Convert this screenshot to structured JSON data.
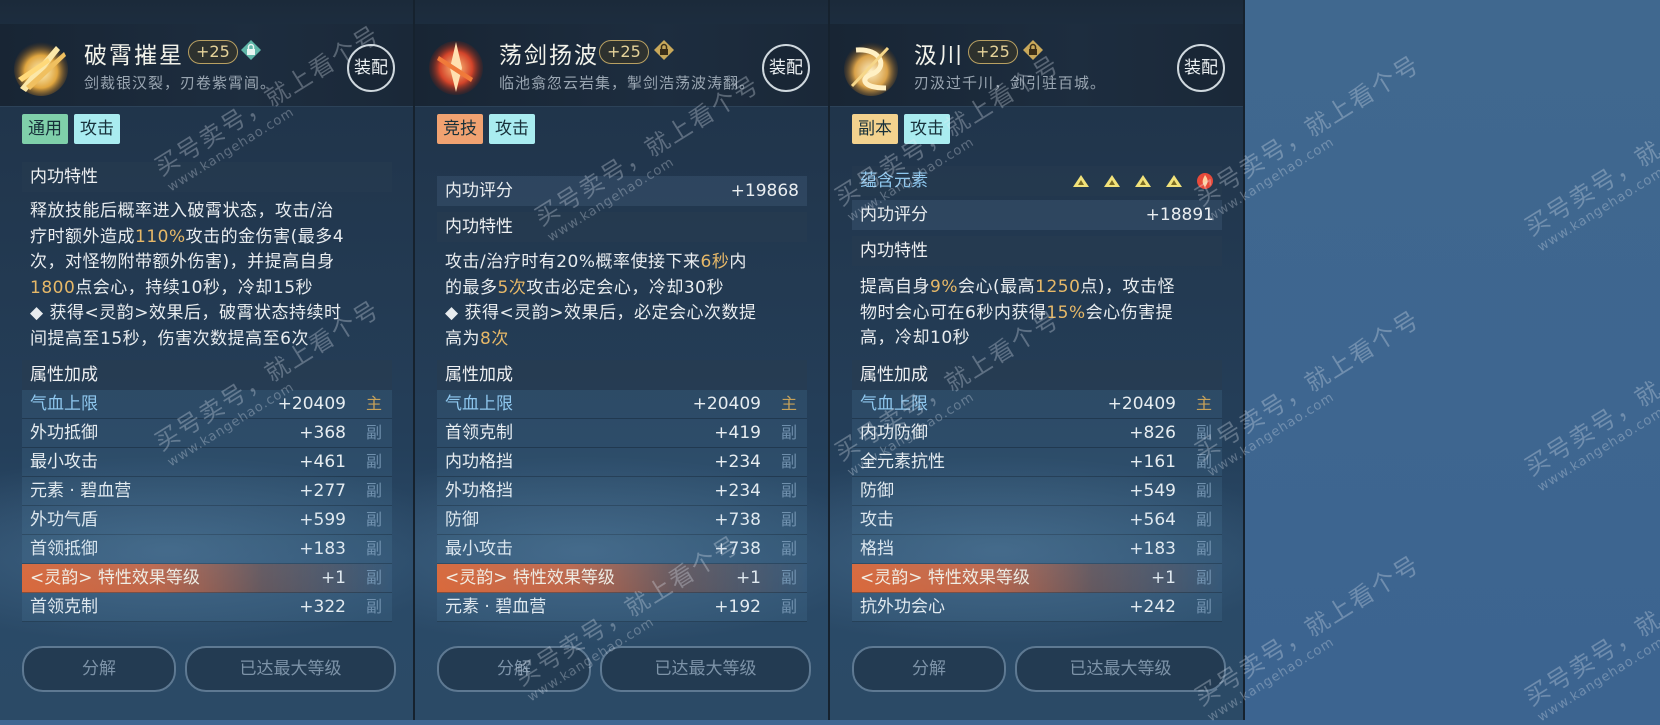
{
  "panels": [
    {
      "name": "破霄摧星",
      "level": "+25",
      "desc": "剑裁银汉裂，刃卷紫霄阊。",
      "equip_label": "装配",
      "tags": [
        {
          "text": "通用",
          "color": "green"
        },
        {
          "text": "攻击",
          "color": "cyan"
        }
      ],
      "trait_title": "内功特性",
      "trait_lines": [
        [
          "释放技能后概率进入破霄状态，攻击/治"
        ],
        [
          "疗时额外造成",
          {
            "hl": "110%"
          },
          "攻击的金伤害(最多4"
        ],
        [
          "次，对怪物附带额外伤害)，并提高自身"
        ],
        [
          {
            "hl": "1800"
          },
          "点会心，持续10秒，冷却15秒"
        ],
        [
          "◆ 获得<灵韵>效果后，破霄状态持续时"
        ],
        [
          "间提高至15秒，伤害次数提高至6次"
        ]
      ],
      "attr_title": "属性加成",
      "stats": [
        {
          "label": "气血上限",
          "value": "+20409",
          "mark": "主"
        },
        {
          "label": "外功抵御",
          "value": "+368",
          "mark": "副"
        },
        {
          "label": "最小攻击",
          "value": "+461",
          "mark": "副"
        },
        {
          "label": "元素 · 碧血营",
          "value": "+277",
          "mark": "副"
        },
        {
          "label": "外功气盾",
          "value": "+599",
          "mark": "副"
        },
        {
          "label": "首领抵御",
          "value": "+183",
          "mark": "副"
        },
        {
          "label": "<灵韵> 特性效果等级",
          "value": "+1",
          "mark": "副",
          "special": true
        },
        {
          "label": "首领克制",
          "value": "+322",
          "mark": "副"
        }
      ],
      "decompose_label": "分解",
      "max_label": "已达最大等级"
    },
    {
      "name": "荡剑扬波",
      "level": "+25",
      "desc": "临池翕忽云岩集，掣剑浩荡波涛翻。",
      "equip_label": "装配",
      "tags": [
        {
          "text": "竞技",
          "color": "orange"
        },
        {
          "text": "攻击",
          "color": "cyan"
        }
      ],
      "score_label": "内功评分",
      "score_value": "+19868",
      "trait_title": "内功特性",
      "trait_lines": [
        [
          "攻击/治疗时有20%概率使接下来",
          {
            "hl": "6秒"
          },
          "内"
        ],
        [
          "的最多",
          {
            "hl": "5次"
          },
          "攻击必定会心，冷却30秒"
        ],
        [
          "◆ 获得<灵韵>效果后，必定会心次数提"
        ],
        [
          "高为",
          {
            "hl": "8次"
          }
        ]
      ],
      "attr_title": "属性加成",
      "stats": [
        {
          "label": "气血上限",
          "value": "+20409",
          "mark": "主"
        },
        {
          "label": "首领克制",
          "value": "+419",
          "mark": "副"
        },
        {
          "label": "内功格挡",
          "value": "+234",
          "mark": "副"
        },
        {
          "label": "外功格挡",
          "value": "+234",
          "mark": "副"
        },
        {
          "label": "防御",
          "value": "+738",
          "mark": "副"
        },
        {
          "label": "最小攻击",
          "value": "+738",
          "mark": "副"
        },
        {
          "label": "<灵韵> 特性效果等级",
          "value": "+1",
          "mark": "副",
          "special": true
        },
        {
          "label": "元素 · 碧血营",
          "value": "+192",
          "mark": "副"
        }
      ],
      "decompose_label": "分解",
      "max_label": "已达最大等级"
    },
    {
      "name": "汲川",
      "level": "+25",
      "desc": "刃汲过千川，剑引驻百城。",
      "equip_label": "装配",
      "tags": [
        {
          "text": "副本",
          "color": "yellow"
        },
        {
          "text": "攻击",
          "color": "cyan"
        }
      ],
      "element_label": "蕴含元素",
      "score_label": "内功评分",
      "score_value": "+18891",
      "trait_title": "内功特性",
      "trait_lines": [
        [
          "提高自身",
          {
            "hl": "9%"
          },
          "会心(最高",
          {
            "hl": "1250"
          },
          "点)，攻击怪"
        ],
        [
          "物时会心可在6秒内获得",
          {
            "hl": "15%"
          },
          "会心伤害提"
        ],
        [
          "高，冷却10秒"
        ]
      ],
      "attr_title": "属性加成",
      "stats": [
        {
          "label": "气血上限",
          "value": "+20409",
          "mark": "主"
        },
        {
          "label": "内功防御",
          "value": "+826",
          "mark": "副"
        },
        {
          "label": "全元素抗性",
          "value": "+161",
          "mark": "副"
        },
        {
          "label": "防御",
          "value": "+549",
          "mark": "副"
        },
        {
          "label": "攻击",
          "value": "+564",
          "mark": "副"
        },
        {
          "label": "格挡",
          "value": "+183",
          "mark": "副"
        },
        {
          "label": "<灵韵> 特性效果等级",
          "value": "+1",
          "mark": "副",
          "special": true
        },
        {
          "label": "抗外功会心",
          "value": "+242",
          "mark": "副"
        }
      ],
      "decompose_label": "分解",
      "max_label": "已达最大等级"
    }
  ],
  "watermark": {
    "text": "买号卖号，就上看个号",
    "url": "www.kangehao.com",
    "badge": "看个号"
  },
  "colors": {
    "highlight": "#e6b868",
    "special_row": "#e0622d",
    "background": "#3f6792"
  }
}
